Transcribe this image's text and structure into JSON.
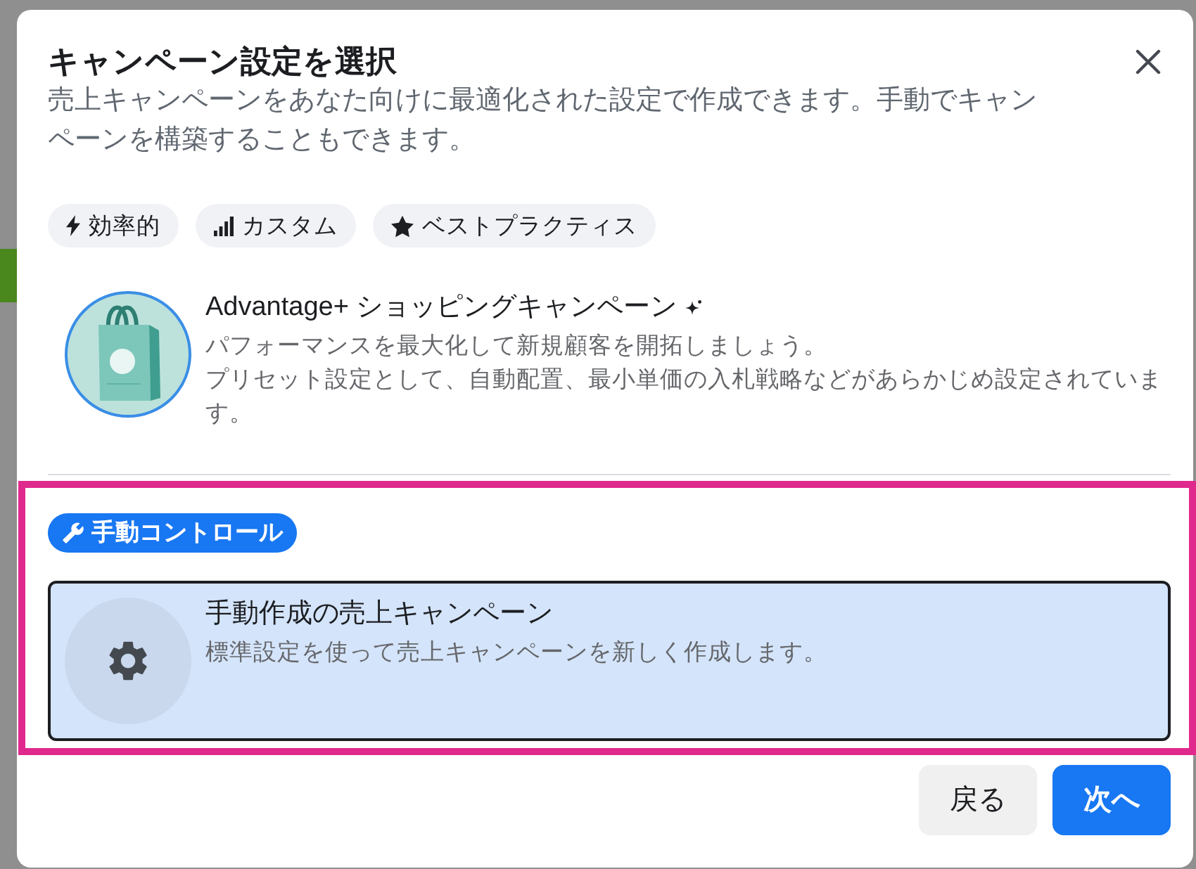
{
  "dialog": {
    "title": "キャンペーン設定を選択",
    "description": "売上キャンペーンをあなた向けに最適化された設定で作成できます。手動でキャンペーンを構築することもできます。"
  },
  "tags": [
    {
      "kind": "bolt",
      "label": "効率的"
    },
    {
      "kind": "chart",
      "label": "カスタム"
    },
    {
      "kind": "star",
      "label": "ベストプラクティス"
    }
  ],
  "options": [
    {
      "kind": "shopping",
      "title": "Advantage+ ショッピングキャンペーン",
      "lines": [
        "パフォーマンスを最大化して新規顧客を開拓しましょう。",
        "プリセット設定として、自動配置、最小単価の入札戦略などがあらかじめ設定されています。"
      ],
      "selected": false
    }
  ],
  "manual_section": {
    "highlighted": true,
    "badge": "手動コントロール",
    "options": [
      {
        "kind": "manual",
        "title": "手動作成の売上キャンペーン",
        "lines": [
          "標準設定を使って売上キャンペーンを新しく作成します。"
        ],
        "selected": true
      }
    ]
  },
  "buttons": [
    {
      "kind": "secondary",
      "label": "戻る"
    },
    {
      "kind": "primary",
      "label": "次へ"
    }
  ]
}
